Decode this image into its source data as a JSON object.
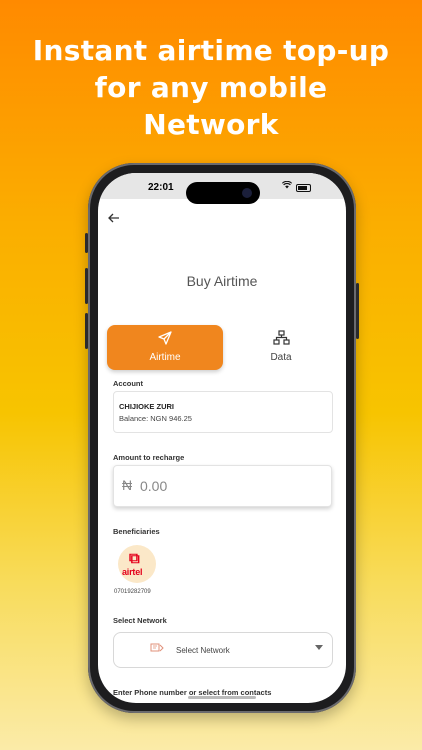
{
  "headline": {
    "line1": "Instant airtime top-up",
    "line2": "for any mobile",
    "line3": "Network"
  },
  "status_bar": {
    "time": "22:01",
    "wifi_icon": "wifi-icon",
    "battery_icon": "battery-icon"
  },
  "header": {
    "back_icon": "arrow-left-icon",
    "title": "Buy Airtime"
  },
  "tabs": [
    {
      "label": "Airtime",
      "icon": "send-icon",
      "active": true
    },
    {
      "label": "Data",
      "icon": "network-icon",
      "active": false
    }
  ],
  "account": {
    "label": "Account",
    "name": "CHIJIOKE ZURI",
    "balance": "Balance: NGN 946.25"
  },
  "amount": {
    "label": "Amount to recharge",
    "currency_symbol": "₦",
    "value": "0.00"
  },
  "beneficiaries": {
    "label": "Beneficiaries",
    "items": [
      {
        "network": "airtel",
        "number": "07019282709"
      }
    ]
  },
  "network_select": {
    "label": "Select Network",
    "placeholder": "Select Network"
  },
  "phone_field": {
    "label": "Enter Phone number or select from contacts"
  },
  "colors": {
    "accent": "#F0861E",
    "bg_top": "#FF8A00",
    "bg_bottom": "#FBEBA8",
    "airtel_red": "#E4001B"
  }
}
